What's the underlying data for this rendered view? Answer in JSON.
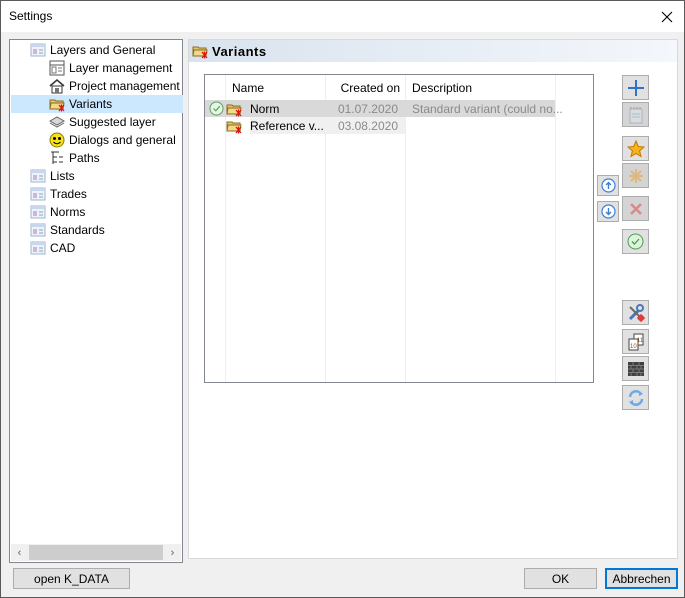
{
  "window": {
    "title": "Settings",
    "close_label": "✕"
  },
  "tree": {
    "items": [
      {
        "label": "Layers and General",
        "icon": "list-page-icon",
        "level": 0
      },
      {
        "label": "Layer management",
        "icon": "layer-management-icon",
        "level": 1
      },
      {
        "label": "Project management",
        "icon": "house-icon",
        "level": 1
      },
      {
        "label": "Variants",
        "icon": "variant-folder-icon",
        "level": 1,
        "selected": true
      },
      {
        "label": "Suggested layer",
        "icon": "layer-stack-icon",
        "level": 1
      },
      {
        "label": "Dialogs and general",
        "icon": "smiley-icon",
        "level": 1
      },
      {
        "label": "Paths",
        "icon": "path-tree-icon",
        "level": 1
      },
      {
        "label": "Lists",
        "icon": "list-page-icon",
        "level": 0
      },
      {
        "label": "Trades",
        "icon": "list-page-icon",
        "level": 0
      },
      {
        "label": "Norms",
        "icon": "list-page-icon",
        "level": 0
      },
      {
        "label": "Standards",
        "icon": "list-page-icon",
        "level": 0
      },
      {
        "label": "CAD",
        "icon": "list-page-icon",
        "level": 0
      }
    ],
    "scroll_left": "‹",
    "scroll_right": "›"
  },
  "panel": {
    "title": "Variants",
    "grid": {
      "columns": [
        "Name",
        "Created on",
        "Description"
      ],
      "rows": [
        {
          "active": true,
          "name": "Norm",
          "created": "01.07.2020",
          "description": "Standard variant (could no..."
        },
        {
          "active": false,
          "name": "Reference v...",
          "created": "03.08.2020",
          "description": ""
        }
      ]
    },
    "toolbar": [
      {
        "name": "add-button",
        "icon": "plus-icon",
        "enabled": true
      },
      {
        "name": "edit-button",
        "icon": "notepad-icon",
        "enabled": false
      },
      {
        "name": "set-default-button",
        "icon": "star-icon",
        "enabled": true
      },
      {
        "name": "reset-default-button",
        "icon": "asterisk-icon",
        "enabled": false
      },
      {
        "name": "delete-button",
        "icon": "delete-x-icon",
        "enabled": false
      },
      {
        "name": "activate-button",
        "icon": "check-circle-icon",
        "enabled": true
      },
      {
        "name": "tools-button",
        "icon": "tools-icon",
        "enabled": true
      },
      {
        "name": "copy-button",
        "icon": "copy-pages-icon",
        "enabled": true
      },
      {
        "name": "wall-button",
        "icon": "brick-wall-icon",
        "enabled": true
      },
      {
        "name": "refresh-button",
        "icon": "refresh-icon",
        "enabled": true
      }
    ],
    "move_up": "move-up-icon",
    "move_down": "move-down-icon"
  },
  "footer": {
    "open_kdata": "open K_DATA",
    "ok": "OK",
    "cancel": "Abbrechen"
  }
}
